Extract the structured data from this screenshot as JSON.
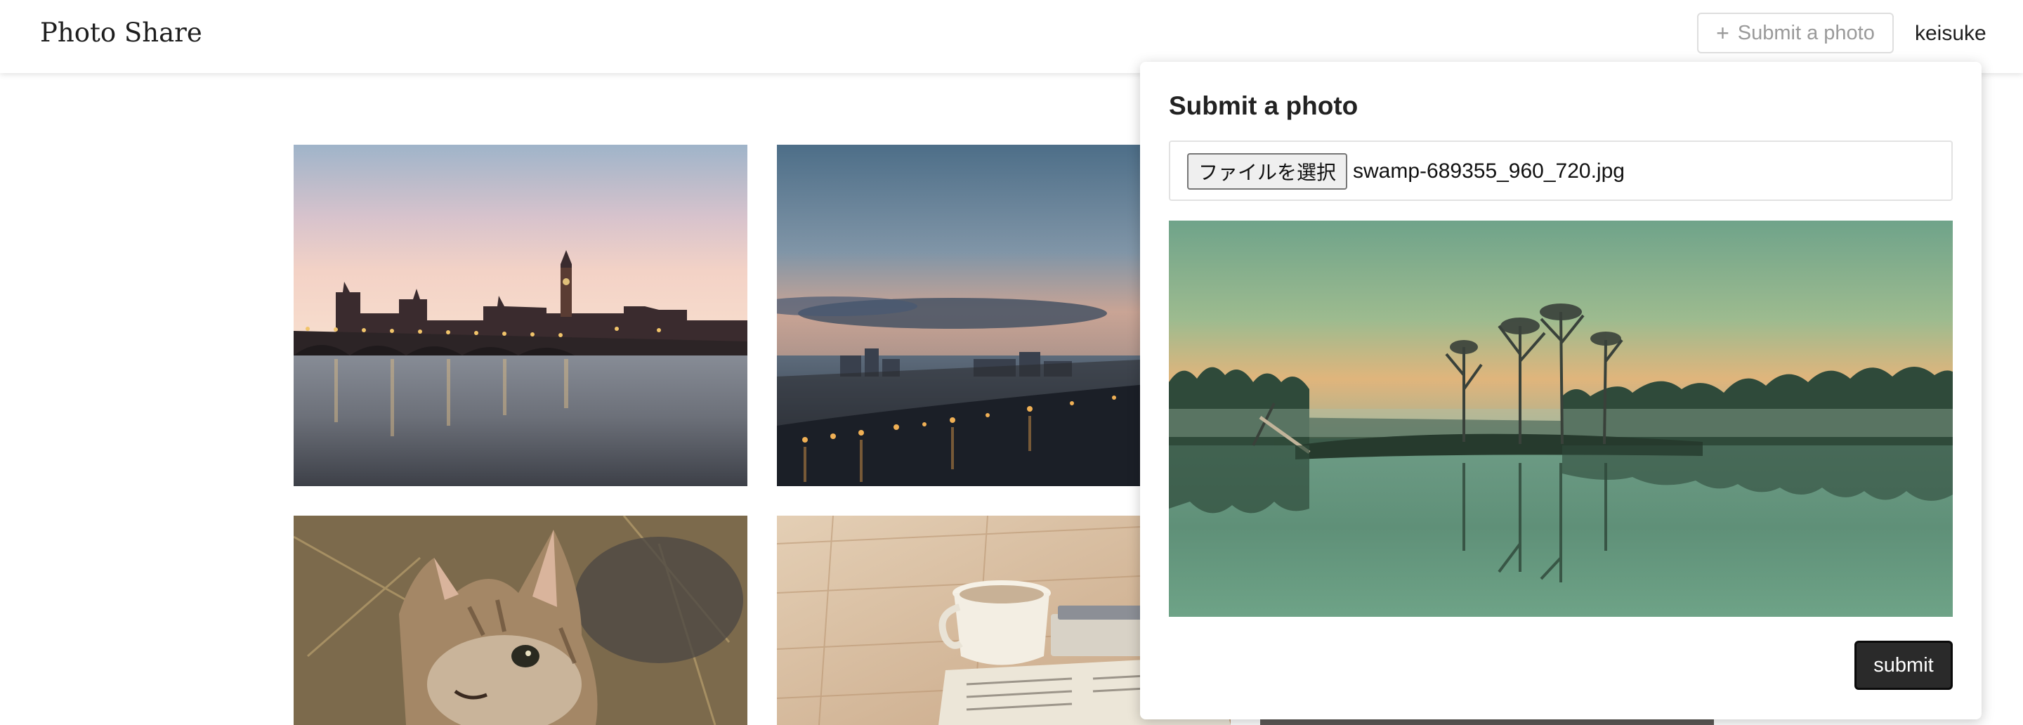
{
  "header": {
    "brand": "Photo Share",
    "submit_label": "Submit a photo",
    "plus_glyph": "+",
    "username": "keisuke"
  },
  "gallery": {
    "photos": [
      {
        "subject": "london-bridge-dusk"
      },
      {
        "subject": "city-waterfront-dusk"
      },
      {
        "subject": "kitten"
      },
      {
        "subject": "coffee-cup-on-table"
      }
    ]
  },
  "submit_panel": {
    "title": "Submit a photo",
    "file_button_label": "ファイルを選択",
    "file_name": "swamp-689355_960_720.jpg",
    "submit_label": "submit"
  },
  "icons": {
    "plus": "plus-icon"
  },
  "colors": {
    "submit_button_bg": "#2a2a2a",
    "muted_text": "#9a9a9a"
  }
}
